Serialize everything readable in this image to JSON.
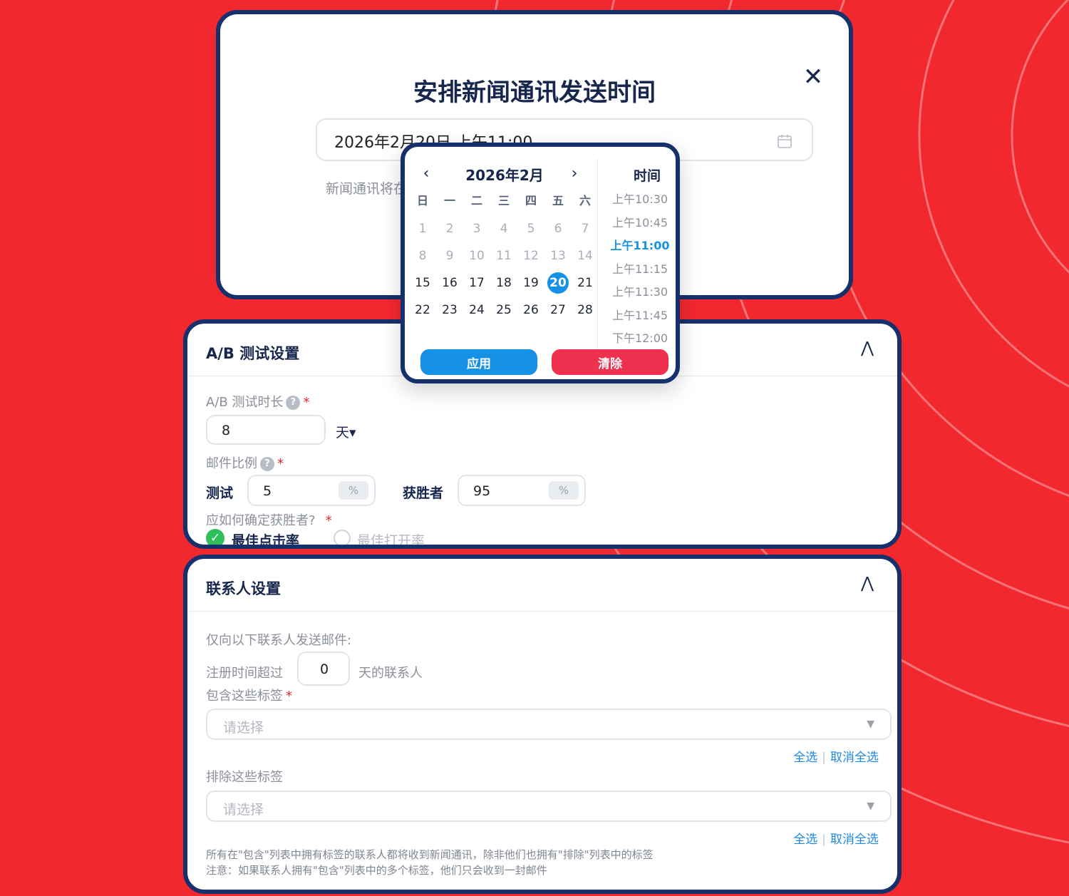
{
  "modal": {
    "title": "安排新闻通讯发送时间",
    "datetime_value": "2026年2月20日 上午11:00",
    "hint": "新闻通讯将在"
  },
  "picker": {
    "month_label": "2026年2月",
    "weekdays": [
      "日",
      "一",
      "二",
      "三",
      "四",
      "五",
      "六"
    ],
    "days": [
      "1",
      "2",
      "3",
      "4",
      "5",
      "6",
      "7",
      "8",
      "9",
      "10",
      "11",
      "12",
      "13",
      "14",
      "15",
      "16",
      "17",
      "18",
      "19",
      "20",
      "21",
      "22",
      "23",
      "24",
      "25",
      "26",
      "27",
      "28"
    ],
    "disabled_through": 14,
    "selected_day": "20",
    "time_heading": "时间",
    "times": [
      "上午10:30",
      "上午10:45",
      "上午11:00",
      "上午11:15",
      "上午11:30",
      "上午11:45",
      "下午12:00"
    ],
    "selected_time": "上午11:00",
    "apply_label": "应用",
    "clear_label": "清除",
    "colors": {
      "accent": "#1592e6",
      "danger": "#f0304f"
    }
  },
  "ab_test": {
    "title": "A/B 测试设置",
    "duration_label": "A/B 测试时长",
    "duration_value": "8",
    "duration_unit": "天▾",
    "ratio_label": "邮件比例",
    "test_label": "测试",
    "test_value": "5",
    "winner_label": "获胜者",
    "winner_value": "95",
    "percent_sign": "%",
    "decide_label": "应如何确定获胜者?",
    "option_click": "最佳点击率",
    "option_open": "最佳打开率",
    "help_glyph": "?"
  },
  "contacts": {
    "title": "联系人设置",
    "send_only_label": "仅向以下联系人发送邮件:",
    "registered_prefix": "注册时间超过",
    "registered_days": "0",
    "registered_suffix": "天的联系人",
    "include_label": "包含这些标签",
    "include_placeholder": "请选择",
    "exclude_label": "排除这些标签",
    "exclude_placeholder": "请选择",
    "select_all": "全选",
    "deselect_all": "取消全选",
    "note_1": "所有在\"包含\"列表中拥有标签的联系人都将收到新闻通讯，除非他们也拥有\"排除\"列表中的标签",
    "note_2": "注意：如果联系人拥有\"包含\"列表中的多个标签，他们只会收到一封邮件"
  },
  "colors": {
    "background": "#f2282f",
    "card_border": "#16306b",
    "success": "#2fbf5a",
    "link": "#1e88e5"
  }
}
